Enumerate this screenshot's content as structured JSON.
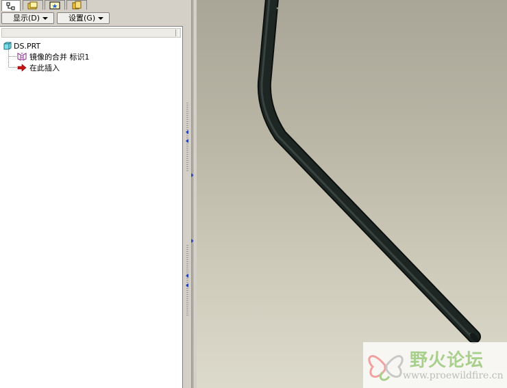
{
  "navigator": {
    "tabs": [
      {
        "icon": "model-tree-icon",
        "active": true
      },
      {
        "icon": "folder-browser-icon",
        "active": false
      },
      {
        "icon": "favorites-icon",
        "active": false
      },
      {
        "icon": "layers-icon",
        "active": false
      }
    ],
    "toolbar": {
      "show_label": "显示(D)",
      "settings_label": "设置(G)"
    },
    "tree": {
      "root": "DS.PRT",
      "items": [
        {
          "label": "镜像的合并 标识1",
          "icon": "mirror-merge-icon"
        },
        {
          "label": "在此插入",
          "icon": "insert-here-arrow-icon"
        }
      ]
    }
  },
  "viewport": {
    "model": "bent-tube",
    "model_color": "#1e2624"
  },
  "watermark": {
    "title": "野火论坛",
    "url": "www.proewildfire.cn"
  }
}
